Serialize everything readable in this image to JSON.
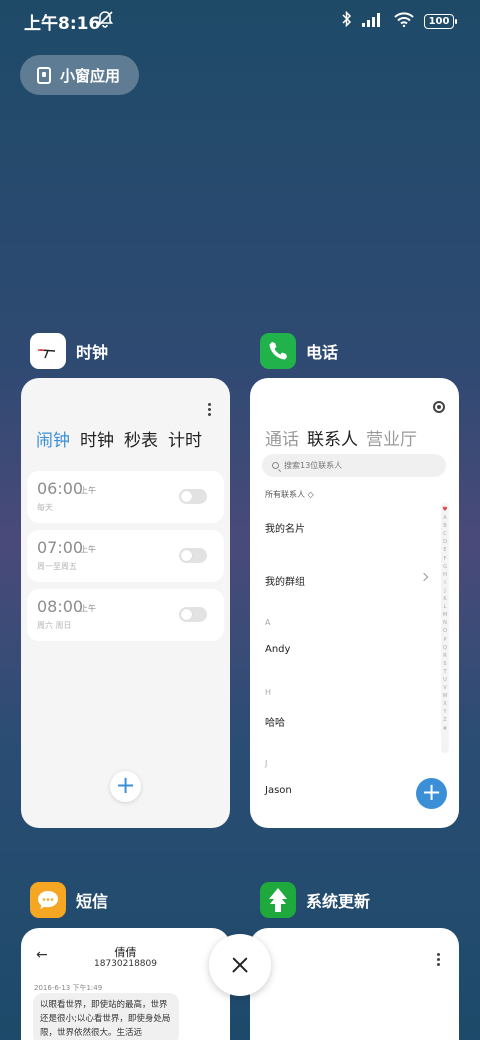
{
  "status_bar": {
    "time": "上午8:16",
    "battery": "100",
    "icons": [
      "bell-off-icon",
      "bluetooth-icon",
      "signal-icon",
      "wifi-icon",
      "battery-icon"
    ]
  },
  "small_window": {
    "label": "小窗应用"
  },
  "apps": {
    "clock": {
      "name": "时钟",
      "tabs": [
        "闹钟",
        "时钟",
        "秒表",
        "计时"
      ],
      "alarms": [
        {
          "time": "06:00",
          "ampm": "上午",
          "repeat": "每天",
          "enabled": false
        },
        {
          "time": "07:00",
          "ampm": "上午",
          "repeat": "周一至周五",
          "enabled": false
        },
        {
          "time": "08:00",
          "ampm": "上午",
          "repeat": "周六 周日",
          "enabled": false
        }
      ],
      "add_label": "+"
    },
    "phone": {
      "name": "电话",
      "tabs": [
        "通话",
        "联系人",
        "营业厅"
      ],
      "search_placeholder": "搜索13位联系人",
      "group_label": "所有联系人",
      "my_card": "我的名片",
      "my_groups": "我的群组",
      "sections": [
        {
          "letter": "A",
          "contact": "Andy"
        },
        {
          "letter": "H",
          "contact": "哈哈"
        },
        {
          "letter": "J",
          "contact": "Jason"
        }
      ],
      "index_letters": [
        "♥",
        "A",
        "B",
        "C",
        "D",
        "E",
        "F",
        "G",
        "H",
        "I",
        "J",
        "K",
        "L",
        "M",
        "N",
        "O",
        "P",
        "Q",
        "R",
        "S",
        "T",
        "U",
        "V",
        "W",
        "X",
        "Y",
        "Z",
        "#"
      ],
      "add_label": "+"
    },
    "sms": {
      "name": "短信",
      "contact_name": "倩倩",
      "contact_number": "18730218809",
      "date": "2016-6-13 下午1:49",
      "message": "以眼看世界，即使站的最高，世界还是很小;以心看世界，即使身处局限，世界依然很大。生活远"
    },
    "update": {
      "name": "系统更新"
    }
  },
  "colors": {
    "accent": "#3a8fd6",
    "clock_icon_bg": "#ffffff",
    "phone_icon_bg": "#22b24c",
    "sms_icon_bg": "#f5a623",
    "update_icon_bg": "#1fa83c"
  }
}
